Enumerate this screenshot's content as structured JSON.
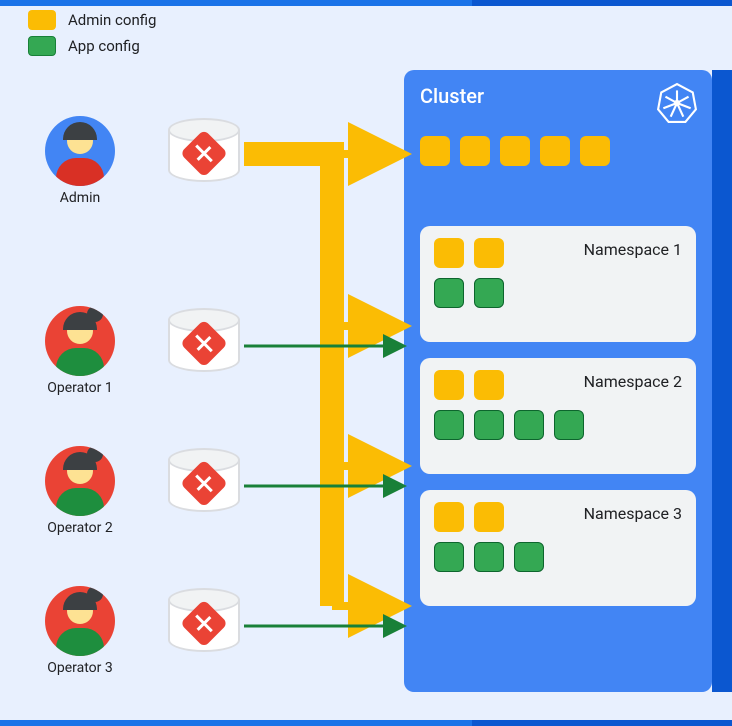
{
  "legend": {
    "admin_config": "Admin config",
    "app_config": "App config"
  },
  "actors": {
    "admin": "Admin",
    "operator1": "Operator 1",
    "operator2": "Operator 2",
    "operator3": "Operator 3"
  },
  "cluster": {
    "title": "Cluster",
    "namespaces": {
      "ns1": "Namespace 1",
      "ns2": "Namespace 2",
      "ns3": "Namespace 3"
    }
  },
  "colors": {
    "admin_config": "#fbbc04",
    "app_config": "#34a853",
    "cluster_bg": "#4285f4",
    "git": "#ea4335"
  },
  "chart_data": {
    "type": "diagram",
    "description": "Config Sync multi-repo model: one admin repo syncs cluster-scoped admin config to the cluster; three operator repos each sync app config to their own namespace, while inheriting admin config.",
    "repos": [
      {
        "owner": "Admin",
        "role": "admin",
        "targets": [
          "cluster",
          "Namespace 1",
          "Namespace 2",
          "Namespace 3"
        ],
        "config_kind": "admin"
      },
      {
        "owner": "Operator 1",
        "role": "operator",
        "targets": [
          "Namespace 1"
        ],
        "config_kind": "app"
      },
      {
        "owner": "Operator 2",
        "role": "operator",
        "targets": [
          "Namespace 2"
        ],
        "config_kind": "app"
      },
      {
        "owner": "Operator 3",
        "role": "operator",
        "targets": [
          "Namespace 3"
        ],
        "config_kind": "app"
      }
    ],
    "cluster_admin_config_count": 5,
    "namespaces": [
      {
        "name": "Namespace 1",
        "admin_config_count": 2,
        "app_config_count": 2
      },
      {
        "name": "Namespace 2",
        "admin_config_count": 2,
        "app_config_count": 4
      },
      {
        "name": "Namespace 3",
        "admin_config_count": 2,
        "app_config_count": 3
      }
    ]
  }
}
